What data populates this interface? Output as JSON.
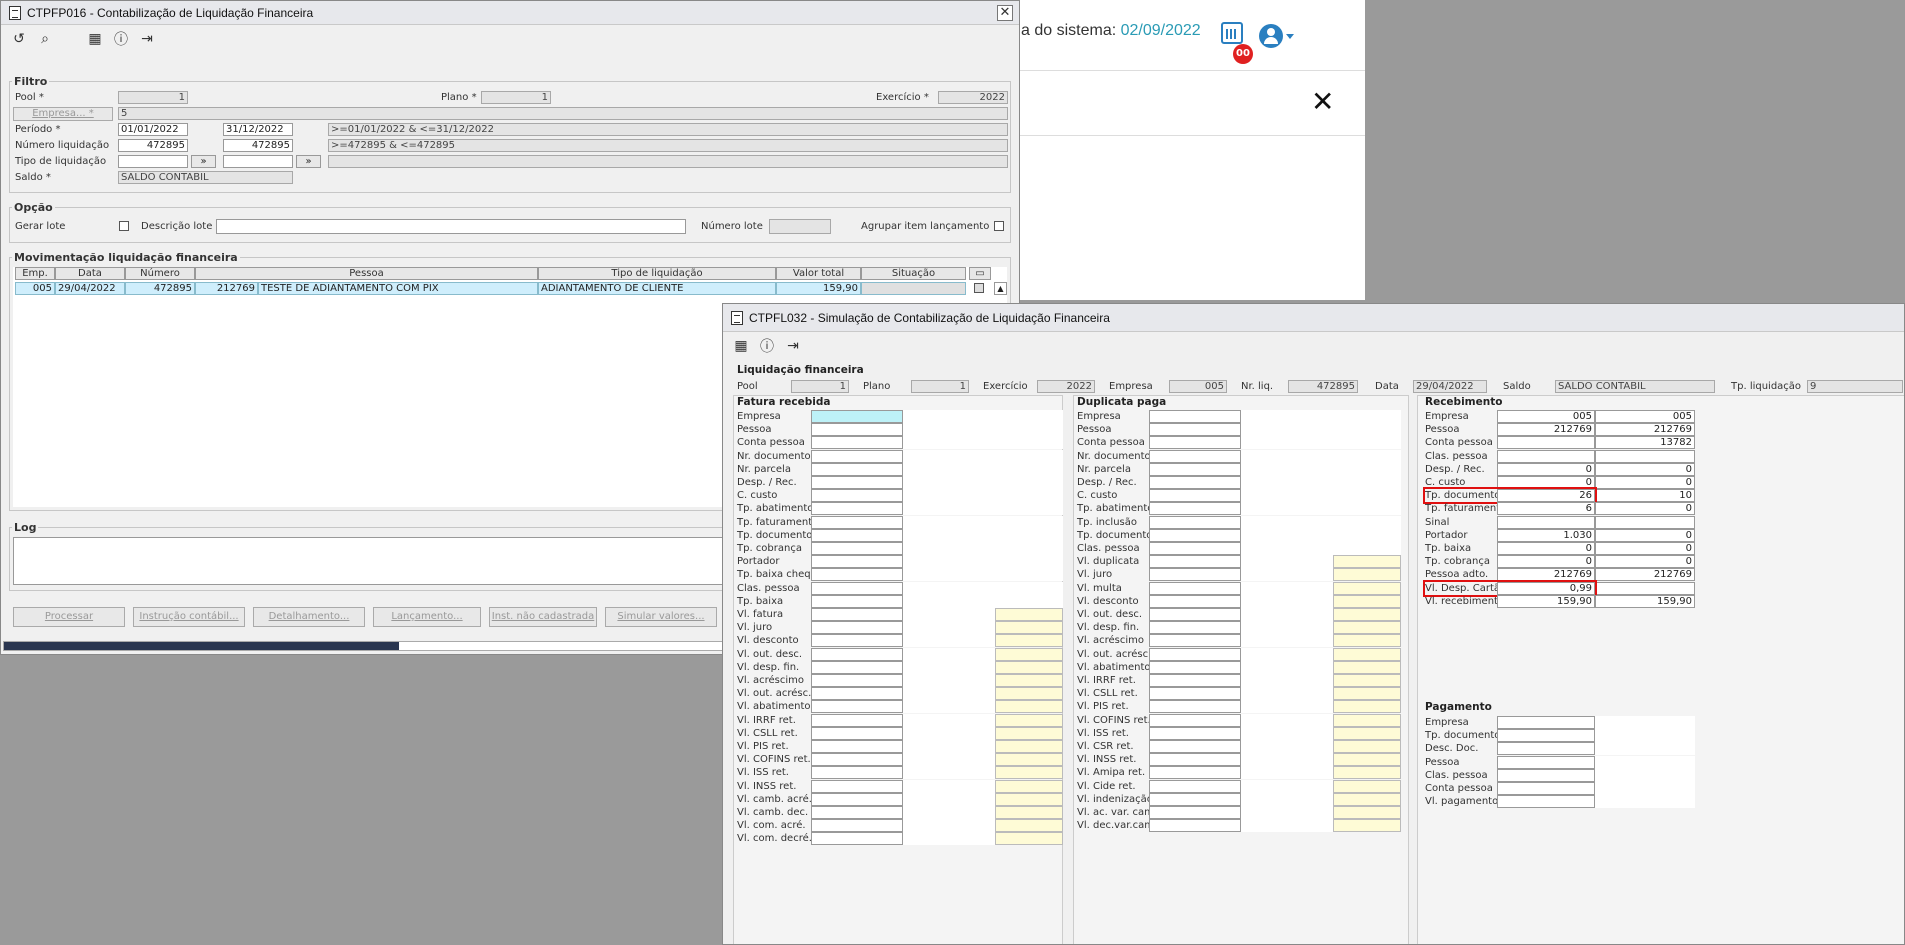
{
  "background_app": {
    "system_date_label": "a do sistema:",
    "system_date_value": "02/09/2022",
    "notification_count": "00",
    "close_glyph": "✕"
  },
  "win1": {
    "title": "CTPFP016 - Contabilização de Liquidação Financeira",
    "close": "✕",
    "filtro": {
      "legend": "Filtro",
      "pool_label": "Pool *",
      "pool_value": "1",
      "plano_label": "Plano *",
      "plano_value": "1",
      "exercicio_label": "Exercício *",
      "exercicio_value": "2022",
      "empresa_button": "Empresa... *",
      "empresa_value": "5",
      "periodo_label": "Período *",
      "periodo_from": "01/01/2022",
      "periodo_to": "31/12/2022",
      "periodo_expr": ">=01/01/2022 & <=31/12/2022",
      "numero_label": "Número liquidação",
      "numero_from": "472895",
      "numero_to": "472895",
      "numero_expr": ">=472895 & <=472895",
      "tipo_label": "Tipo de liquidação",
      "saldo_label": "Saldo *",
      "saldo_value": "SALDO CONTABIL"
    },
    "opcao": {
      "legend": "Opção",
      "gerar_lote": "Gerar lote",
      "descricao_lote": "Descrição lote",
      "numero_lote": "Número lote",
      "agrupar": "Agrupar item lançamento"
    },
    "mov": {
      "legend": "Movimentação liquidação financeira",
      "headers": [
        "Emp.",
        "Data",
        "Número",
        "Pessoa",
        "Tipo de liquidação",
        "Valor total",
        "Situação"
      ],
      "row": {
        "emp": "005",
        "data": "29/04/2022",
        "numero": "472895",
        "pessoa_cod": "212769",
        "pessoa_nome": "TESTE DE ADIANTAMENTO COM PIX",
        "tipo": "ADIANTAMENTO DE CLIENTE",
        "valor": "159,90"
      }
    },
    "log_legend": "Log",
    "buttons": [
      "Processar",
      "Instrução contábil...",
      "Detalhamento...",
      "Lançamento...",
      "Inst. não cadastrada",
      "Simular valores..."
    ]
  },
  "win2": {
    "title": "CTPFL032 - Simulação de Contabilização de Liquidação Financeira",
    "liq_title": "Liquidação financeira",
    "header_fields": [
      {
        "label": "Pool",
        "value": "1"
      },
      {
        "label": "Plano",
        "value": "1"
      },
      {
        "label": "Exercício",
        "value": "2022"
      },
      {
        "label": "Empresa",
        "value": "005"
      },
      {
        "label": "Nr. liq.",
        "value": "472895"
      },
      {
        "label": "Data",
        "value": "29/04/2022"
      },
      {
        "label": "Saldo",
        "value": "SALDO CONTABIL"
      },
      {
        "label": "Tp. liquidação",
        "value": "9"
      }
    ],
    "fatura_title": "Fatura recebida",
    "fatura_labels": [
      "Empresa",
      "Pessoa",
      "Conta pessoa",
      "Nr. documento",
      "Nr. parcela",
      "Desp. / Rec.",
      "C. custo",
      "Tp. abatimento",
      "Tp. faturamento",
      "Tp. documento",
      "Tp. cobrança",
      "Portador",
      "Tp. baixa cheq.",
      "Clas. pessoa",
      "Tp. baixa",
      "Vl. fatura",
      "Vl. juro",
      "Vl. desconto",
      "Vl. out. desc.",
      "Vl. desp. fin.",
      "Vl. acréscimo",
      "Vl. out. acrésc.",
      "Vl. abatimento",
      "Vl. IRRF ret.",
      "Vl. CSLL ret.",
      "Vl. PIS ret.",
      "Vl. COFINS ret.",
      "Vl. ISS ret.",
      "Vl. INSS ret.",
      "Vl. camb. acré.",
      "Vl. camb. dec.",
      "Vl. com. acré.",
      "Vl. com. decré."
    ],
    "duplicata_title": "Duplicata paga",
    "duplicata_labels": [
      "Empresa",
      "Pessoa",
      "Conta pessoa",
      "Nr. documento",
      "Nr. parcela",
      "Desp. / Rec.",
      "C. custo",
      "Tp. abatimento",
      "Tp. inclusão",
      "Tp. documento",
      "Clas. pessoa",
      "Vl. duplicata",
      "Vl. juro",
      "Vl. multa",
      "Vl. desconto",
      "Vl. out. desc.",
      "Vl. desp. fin.",
      "Vl. acréscimo",
      "Vl. out. acrésc.",
      "Vl. abatimento",
      "Vl. IRRF ret.",
      "Vl. CSLL ret.",
      "Vl. PIS ret.",
      "Vl. COFINS ret.",
      "Vl. ISS ret.",
      "Vl. CSR ret.",
      "Vl. INSS ret.",
      "Vl. Amipa ret.",
      "Vl. Cide ret.",
      "Vl. indenização",
      "Vl. ac. var. camb.",
      "Vl. dec.var.camb."
    ],
    "recebimento_title": "Recebimento",
    "recebimento_rows": [
      {
        "label": "Empresa",
        "v1": "005",
        "v2": "005"
      },
      {
        "label": "Pessoa",
        "v1": "212769",
        "v2": "212769"
      },
      {
        "label": "Conta pessoa",
        "v1": "",
        "v2": "13782"
      },
      {
        "label": "Clas. pessoa",
        "v1": "",
        "v2": ""
      },
      {
        "label": "Desp. / Rec.",
        "v1": "0",
        "v2": "0"
      },
      {
        "label": "C. custo",
        "v1": "0",
        "v2": "0"
      },
      {
        "label": "Tp. documento",
        "v1": "26",
        "v2": "10"
      },
      {
        "label": "Tp. faturamento",
        "v1": "6",
        "v2": "0"
      },
      {
        "label": "Sinal",
        "v1": "",
        "v2": ""
      },
      {
        "label": "Portador",
        "v1": "1.030",
        "v2": "0"
      },
      {
        "label": "Tp. baixa",
        "v1": "0",
        "v2": "0"
      },
      {
        "label": "Tp. cobrança",
        "v1": "0",
        "v2": "0"
      },
      {
        "label": "Pessoa adto.",
        "v1": "212769",
        "v2": "212769"
      },
      {
        "label": "Vl. Desp. Cartão",
        "v1": "0,99",
        "v2": ""
      },
      {
        "label": "Vl. recebimento",
        "v1": "159,90",
        "v2": "159,90"
      }
    ],
    "pagamento_title": "Pagamento",
    "pagamento_labels": [
      "Empresa",
      "Tp. documento",
      "Desc. Doc.",
      "Pessoa",
      "Clas. pessoa",
      "Conta pessoa",
      "Vl. pagamento"
    ]
  }
}
